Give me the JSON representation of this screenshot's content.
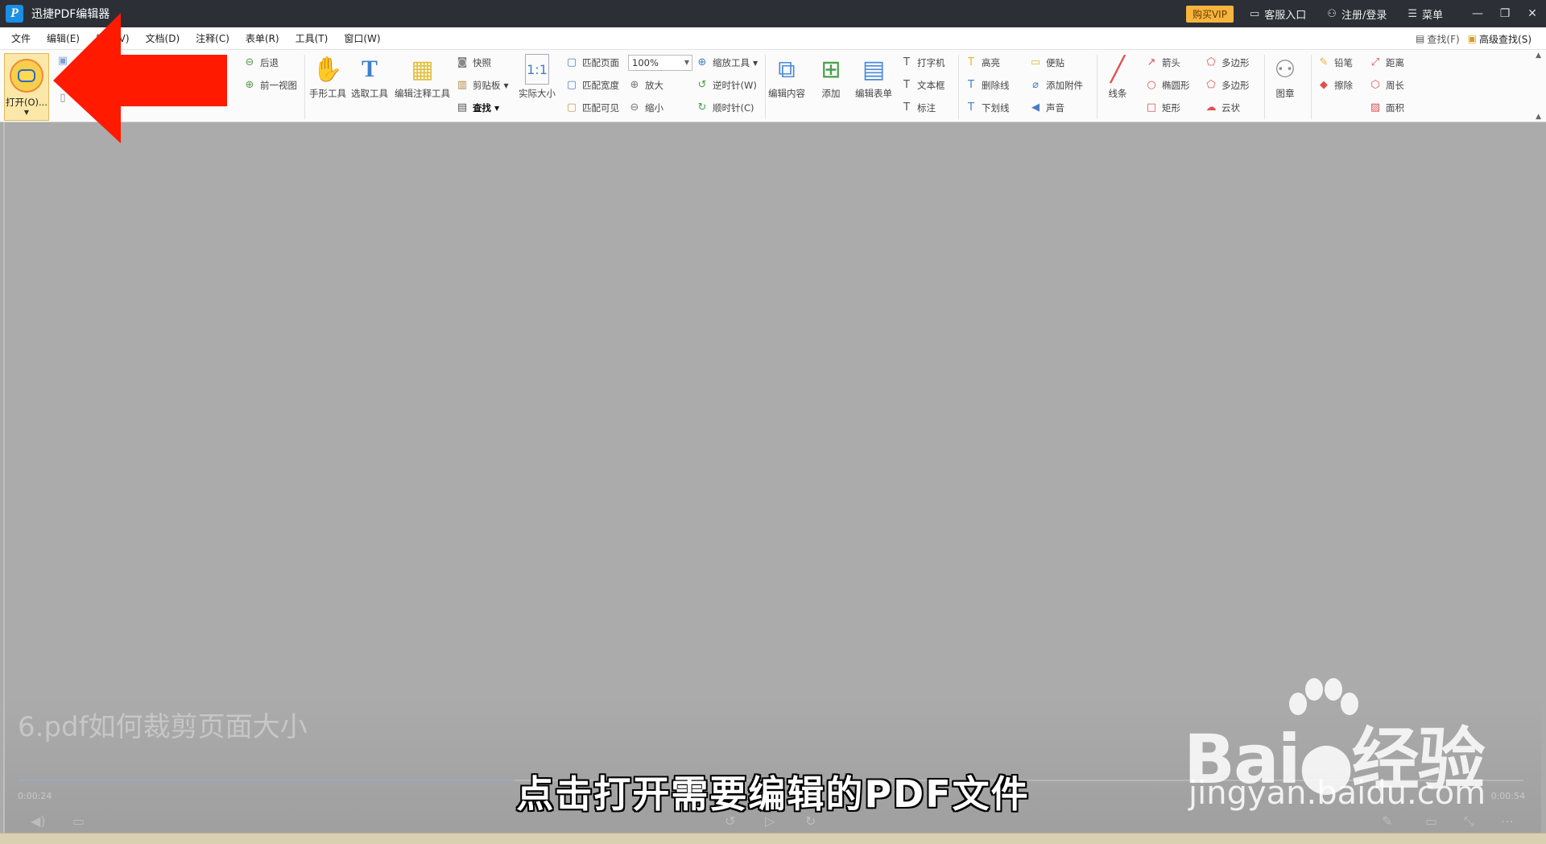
{
  "app": {
    "title": "迅捷PDF编辑器",
    "logo_letter": "P"
  },
  "titlebar": {
    "vip": "购买VIP",
    "service": "客服入口",
    "login": "注册/登录",
    "menu": "菜单",
    "minimize": "—",
    "restore": "❐",
    "close": "✕"
  },
  "menubar": {
    "items": [
      "文件",
      "编辑(E)",
      "视图(V)",
      "文档(D)",
      "注释(C)",
      "表单(R)",
      "工具(T)",
      "窗口(W)"
    ],
    "find": "查找(F)",
    "advanced_find": "高级查找(S)"
  },
  "ribbon": {
    "open": "打开(O)...",
    "back": "后退",
    "prev_view": "前一视图",
    "hand_tool": "手形工具",
    "select_tool": "选取工具",
    "edit_annot_tool": "编辑注释工具",
    "snapshot": "快照",
    "clipboard": "剪贴板",
    "search": "查找",
    "actual_size": "实际大小",
    "fit_page": "匹配页面",
    "fit_width": "匹配宽度",
    "fit_visible": "匹配可见",
    "zoom_value": "100%",
    "zoom_tool": "缩放工具",
    "zoom_in": "放大",
    "zoom_out": "缩小",
    "rotate_ccw": "逆时针(W)",
    "rotate_cw": "顺时针(C)",
    "edit_content": "编辑内容",
    "add": "添加",
    "edit_form": "编辑表单",
    "typewriter": "打字机",
    "textbox": "文本框",
    "callout": "标注",
    "highlight": "高亮",
    "strikeout": "删除线",
    "underline": "下划线",
    "note": "便贴",
    "attach": "添加附件",
    "sound": "声音",
    "line": "线条",
    "arrow": "箭头",
    "ellipse": "椭圆形",
    "rect": "矩形",
    "polygon1": "多边形",
    "polygon2": "多边形",
    "cloud": "云状",
    "stamp": "图章",
    "pencil": "铅笔",
    "eraser": "擦除",
    "distance": "距离",
    "perimeter": "周长",
    "area": "面积"
  },
  "video": {
    "title": "6.pdf如何裁剪页面大小",
    "time_current": "0:00:24",
    "time_total": "0:00:54",
    "progress": 0.33,
    "subtitle": "点击打开需要编辑的PDF文件"
  },
  "watermark": {
    "brand": "Bai",
    "brand2": "经验",
    "url": "jingyan.baidu.com"
  },
  "colors": {
    "titlebar": "#2c2f36",
    "vip": "#f5b53d",
    "arrow": "#ff1a00",
    "open_bg": "#fbe7a7"
  }
}
